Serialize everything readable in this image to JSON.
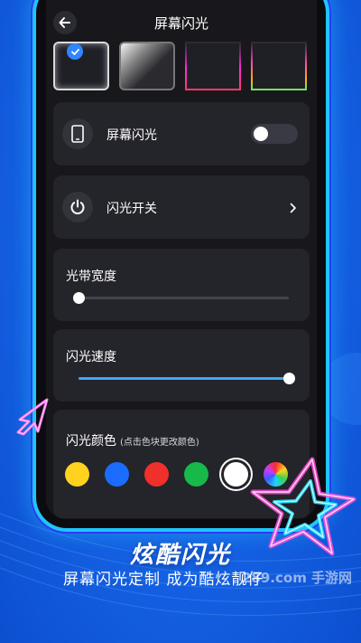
{
  "header": {
    "title": "屏幕闪光"
  },
  "effects": {
    "selected_index": 0,
    "count": 4
  },
  "screen_flash": {
    "label": "屏幕闪光",
    "enabled": false
  },
  "flash_switch": {
    "label": "闪光开关"
  },
  "band_width": {
    "label": "光带宽度",
    "level": 0.0
  },
  "flash_speed": {
    "label": "闪光速度",
    "level": 1.0
  },
  "flash_color": {
    "label": "闪光颜色",
    "hint": "(点击色块更改颜色)",
    "swatches": [
      "#ffd21f",
      "#1a6dff",
      "#f0302a",
      "#16b94a",
      "#ffffff",
      "rainbow"
    ],
    "selected": "#ffffff"
  },
  "promo": {
    "title": "炫酷闪光",
    "subtitle": "屏幕闪光定制 成为酷炫靓仔"
  },
  "watermark": {
    "text": "289.com 手游网"
  },
  "colors": {
    "accent": "#2f86ff",
    "background": "#1766e8",
    "card": "#24242b"
  }
}
